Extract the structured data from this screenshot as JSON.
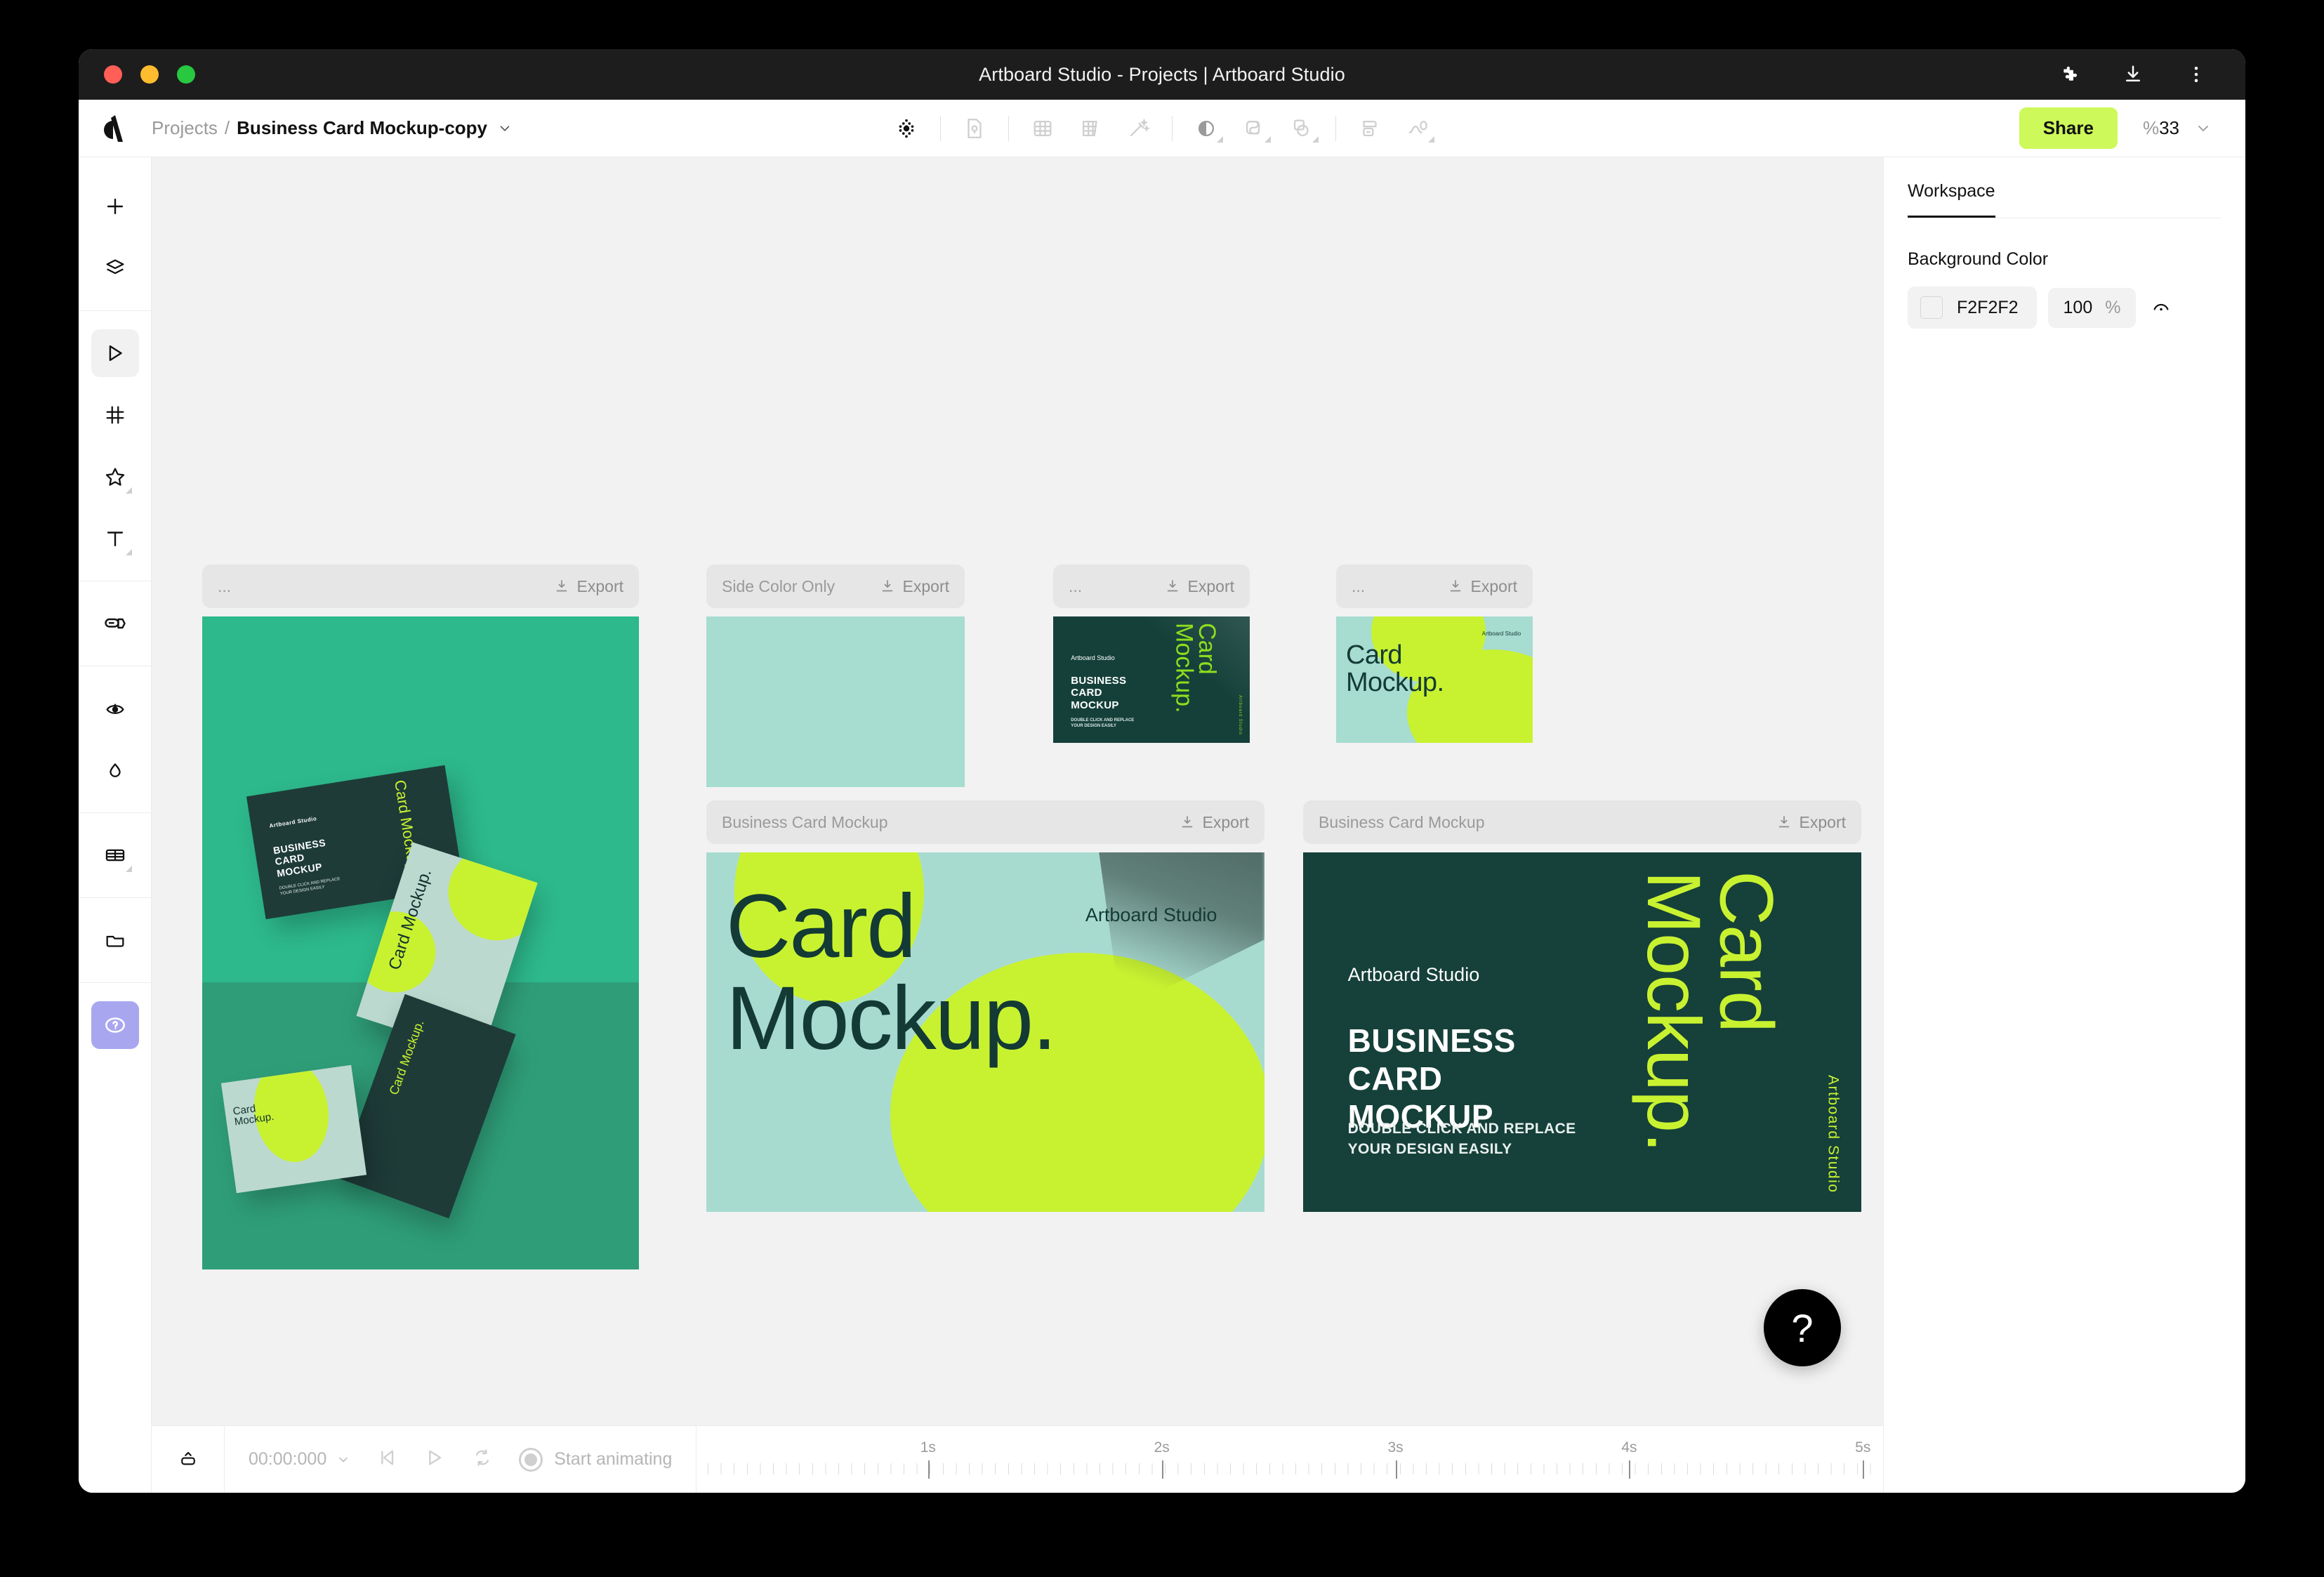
{
  "window": {
    "title": "Artboard Studio - Projects | Artboard Studio",
    "traffic_lights": [
      "close",
      "minimize",
      "zoom"
    ],
    "right_icons": [
      "puzzle-icon",
      "download-icon",
      "kebab-menu-icon"
    ]
  },
  "topbar": {
    "logo": "artboard-studio-logo",
    "breadcrumb": {
      "parent": "Projects",
      "separator": "/",
      "current": "Business Card Mockup-copy"
    },
    "tools": [
      "pattern-icon",
      "file-icon",
      "grid-icon",
      "perspective-grid-icon",
      "magic-wand-icon",
      "opacity-icon",
      "shape-icon",
      "layers-stack-icon",
      "banner-icon",
      "path-icon"
    ],
    "share_label": "Share",
    "zoom_percent_symbol": "%",
    "zoom_value": "33",
    "share_color": "#CDF95A"
  },
  "left_rail": {
    "items": [
      {
        "name": "add-icon",
        "active": false
      },
      {
        "name": "layers-icon",
        "active": false
      },
      {
        "name": "select-cursor-icon",
        "active": true
      },
      {
        "name": "artboard-frame-icon",
        "active": false
      },
      {
        "name": "shape-star-icon",
        "active": false
      },
      {
        "name": "text-icon",
        "active": false
      },
      {
        "name": "sticker-icon",
        "active": false
      },
      {
        "name": "eyedropper-icon",
        "active": false
      },
      {
        "name": "water-drop-icon",
        "active": false
      },
      {
        "name": "table-icon",
        "active": false
      },
      {
        "name": "folder-icon",
        "active": false
      },
      {
        "name": "help-icon",
        "active": false
      }
    ]
  },
  "canvas": {
    "background_color": "#F2F2F2",
    "export_label": "Export",
    "artboards": [
      {
        "id": "artboard-photo-mockup",
        "label": "...",
        "type": "photo",
        "content": {
          "studio": "Artboard Studio",
          "headline": "BUSINESS CARD MOCKUP",
          "sub": "DOUBLE CLICK AND REPLACE YOUR DESIGN EASILY",
          "vertical_title": "Card Mockup."
        }
      },
      {
        "id": "artboard-side-color-only",
        "label": "Side Color Only",
        "type": "solid",
        "content": {
          "color": "#A7DCD0"
        }
      },
      {
        "id": "artboard-dark-card-small",
        "label": "...",
        "type": "dark-card",
        "content": {
          "studio": "Artboard Studio",
          "headline_lines": [
            "BUSINESS",
            "CARD",
            "MOCKUP"
          ],
          "sub_lines": [
            "DOUBLE CLICK AND REPLACE",
            "YOUR DESIGN EASILY"
          ],
          "vertical_title": "Card Mockup.",
          "vertical_studio": "Artboard Studio"
        }
      },
      {
        "id": "artboard-mint-card-small",
        "label": "...",
        "type": "mint-card",
        "content": {
          "title_lines": [
            "Card",
            "Mockup."
          ],
          "studio": "Artboard Studio"
        }
      },
      {
        "id": "artboard-business-card-mockup-mint",
        "label": "Business Card Mockup",
        "type": "mint-large",
        "content": {
          "title_lines": [
            "Card",
            "Mockup."
          ],
          "studio": "Artboard Studio"
        }
      },
      {
        "id": "artboard-business-card-mockup-dark",
        "label": "Business Card Mockup",
        "type": "dark-large",
        "content": {
          "studio": "Artboard Studio",
          "headline_lines": [
            "BUSINESS",
            "CARD",
            "MOCKUP"
          ],
          "sub_lines": [
            "DOUBLE CLICK AND REPLACE",
            "YOUR DESIGN EASILY"
          ],
          "vertical_title": "Card Mockup.",
          "vertical_studio": "Artboard Studio"
        }
      }
    ],
    "help_fab": "?"
  },
  "right_panel": {
    "tab": "Workspace",
    "section_title": "Background Color",
    "hex_value": "F2F2F2",
    "opacity_value": "100",
    "opacity_unit": "%",
    "reset_icon": "visibility-icon"
  },
  "timeline": {
    "collapse_icon": "collapse-panel-icon",
    "time_value": "00:00:000",
    "controls": [
      "skip-to-start-icon",
      "play-icon",
      "loop-icon",
      "record-icon"
    ],
    "start_label": "Start animating",
    "ruler_labels": [
      "1s",
      "2s",
      "3s",
      "4s",
      "5s"
    ]
  }
}
